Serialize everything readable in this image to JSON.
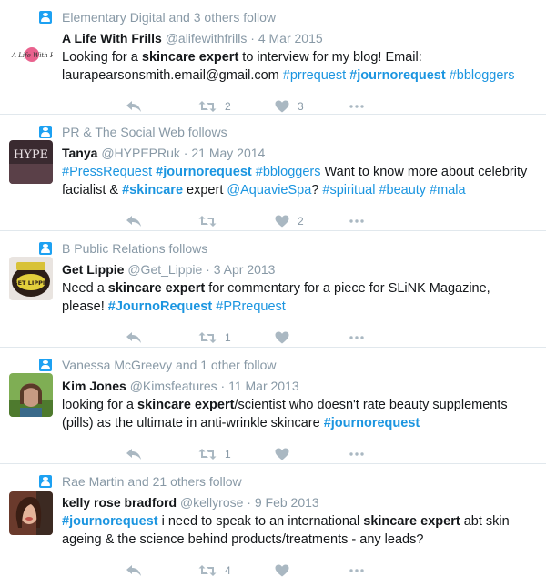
{
  "tweets": [
    {
      "context": "Elementary Digital and 3 others follow",
      "name": "A Life With Frills",
      "handle": "@alifewithfrills",
      "date": "4 Mar 2015",
      "avatar_text": "A Life With Frills",
      "segments": [
        {
          "t": "Looking for a ",
          "type": "plain"
        },
        {
          "t": "skincare expert",
          "type": "bold"
        },
        {
          "t": " to interview for my blog! Email: laurapearsonsmith.email@gmail.com ",
          "type": "plain"
        },
        {
          "t": "#prrequest",
          "type": "tag"
        },
        {
          "t": " ",
          "type": "plain"
        },
        {
          "t": "#journorequest",
          "type": "tagbold"
        },
        {
          "t": " ",
          "type": "plain"
        },
        {
          "t": "#bbloggers",
          "type": "tag"
        }
      ],
      "retweets": "2",
      "likes": "3"
    },
    {
      "context": "PR & The Social Web follows",
      "name": "Tanya",
      "handle": "@HYPEPRuk",
      "date": "21 May 2014",
      "avatar_text": "HYPE",
      "segments": [
        {
          "t": "#PressRequest",
          "type": "tag"
        },
        {
          "t": " ",
          "type": "plain"
        },
        {
          "t": "#journorequest",
          "type": "tagbold"
        },
        {
          "t": " ",
          "type": "plain"
        },
        {
          "t": "#bbloggers",
          "type": "tag"
        },
        {
          "t": " Want to know more about celebrity facialist & ",
          "type": "plain"
        },
        {
          "t": "#skincare",
          "type": "tagbold"
        },
        {
          "t": " expert ",
          "type": "plain"
        },
        {
          "t": "@AquavieSpa",
          "type": "mention"
        },
        {
          "t": "? ",
          "type": "plain"
        },
        {
          "t": "#spiritual",
          "type": "tag"
        },
        {
          "t": " ",
          "type": "plain"
        },
        {
          "t": "#beauty",
          "type": "tag"
        },
        {
          "t": " ",
          "type": "plain"
        },
        {
          "t": "#mala",
          "type": "tag"
        }
      ],
      "retweets": "",
      "likes": "2"
    },
    {
      "context": "B Public Relations follows",
      "name": "Get Lippie",
      "handle": "@Get_Lippie",
      "date": "3 Apr 2013",
      "avatar_text": "GET LIPPIE",
      "segments": [
        {
          "t": "Need a ",
          "type": "plain"
        },
        {
          "t": "skincare expert",
          "type": "bold"
        },
        {
          "t": " for commentary for a piece for SLiNK Magazine, please! ",
          "type": "plain"
        },
        {
          "t": "#JournoRequest",
          "type": "tagbold"
        },
        {
          "t": " ",
          "type": "plain"
        },
        {
          "t": "#PRrequest",
          "type": "tag"
        }
      ],
      "retweets": "1",
      "likes": ""
    },
    {
      "context": "Vanessa McGreevy and 1 other follow",
      "name": "Kim Jones",
      "handle": "@Kimsfeatures",
      "date": "11 Mar 2013",
      "avatar_text": "",
      "segments": [
        {
          "t": "looking for a ",
          "type": "plain"
        },
        {
          "t": "skincare expert",
          "type": "bold"
        },
        {
          "t": "/scientist who doesn't rate beauty supplements (pills) as the ultimate in anti-wrinkle skincare ",
          "type": "plain"
        },
        {
          "t": "#journorequest",
          "type": "tagbold"
        }
      ],
      "retweets": "1",
      "likes": ""
    },
    {
      "context": "Rae Martin and 21 others follow",
      "name": "kelly rose bradford",
      "handle": "@kellyrose",
      "date": "9 Feb 2013",
      "avatar_text": "",
      "segments": [
        {
          "t": "#journorequest",
          "type": "tagbold"
        },
        {
          "t": " i need to speak to an international ",
          "type": "plain"
        },
        {
          "t": "skincare expert",
          "type": "bold"
        },
        {
          "t": " abt  skin ageing & the science behind products/treatments - any leads?",
          "type": "plain"
        }
      ],
      "retweets": "4",
      "likes": ""
    }
  ],
  "colors": {
    "accent": "#1b95e0",
    "meta": "#8899a6",
    "icon": "#aab8c2",
    "ctx_icon": "#1da1f2"
  }
}
